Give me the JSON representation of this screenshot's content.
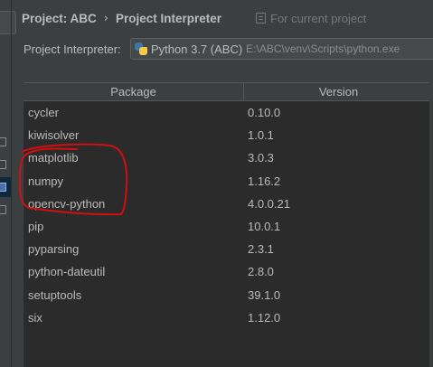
{
  "header": {
    "breadcrumb_project": "Project: ABC",
    "breadcrumb_separator": "›",
    "breadcrumb_page": "Project Interpreter",
    "scope_label": "For current project",
    "scope_icon": "document-icon"
  },
  "interpreter": {
    "label": "Project Interpreter:",
    "name": "Python 3.7 (ABC)",
    "path": "E:\\ABC\\venv\\Scripts\\python.exe",
    "icon": "python-icon"
  },
  "table": {
    "columns": {
      "package": "Package",
      "version": "Version"
    },
    "rows": [
      {
        "package": "cycler",
        "version": "0.10.0"
      },
      {
        "package": "kiwisolver",
        "version": "1.0.1"
      },
      {
        "package": "matplotlib",
        "version": "3.0.3"
      },
      {
        "package": "numpy",
        "version": "1.16.2"
      },
      {
        "package": "opencv-python",
        "version": "4.0.0.21"
      },
      {
        "package": "pip",
        "version": "10.0.1"
      },
      {
        "package": "pyparsing",
        "version": "2.3.1"
      },
      {
        "package": "python-dateutil",
        "version": "2.8.0"
      },
      {
        "package": "setuptools",
        "version": "39.1.0"
      },
      {
        "package": "six",
        "version": "1.12.0"
      }
    ]
  },
  "annotation": {
    "color": "#d01010",
    "circled_rows": [
      "matplotlib",
      "numpy",
      "opencv-python"
    ]
  },
  "colors": {
    "background": "#3c3f41",
    "table_background": "#2b2b2b",
    "text": "#bbbbbb",
    "muted_text": "#787878"
  }
}
